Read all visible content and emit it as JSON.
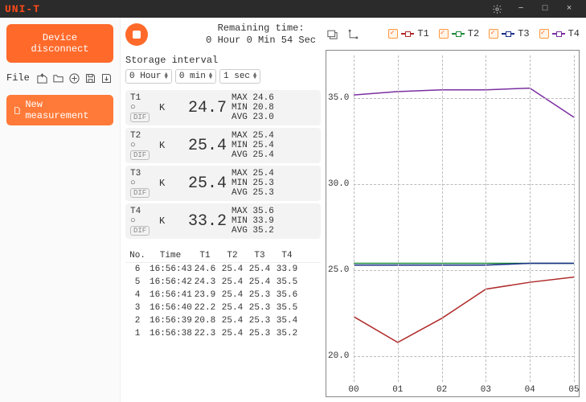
{
  "brand": "UNI-T",
  "window": {
    "gear": "gear",
    "min": "−",
    "max": "□",
    "close": "×"
  },
  "left": {
    "disconnect": "Device disconnect",
    "file_label": "File",
    "new_measurement": "New measurement"
  },
  "header": {
    "remaining_label": "Remaining time:",
    "remaining_value": "0 Hour 0 Min 54 Sec"
  },
  "storage": {
    "label": "Storage interval",
    "hour": "0 Hour",
    "min": "0 min",
    "sec": "1 sec"
  },
  "channels": [
    {
      "name": "T1",
      "unit": "K",
      "value": "24.7",
      "max": "MAX 24.6",
      "min": "MIN 20.8",
      "avg": "AVG 23.0",
      "dif": "DIF"
    },
    {
      "name": "T2",
      "unit": "K",
      "value": "25.4",
      "max": "MAX 25.4",
      "min": "MIN 25.4",
      "avg": "AVG 25.4",
      "dif": "DIF"
    },
    {
      "name": "T3",
      "unit": "K",
      "value": "25.4",
      "max": "MAX 25.4",
      "min": "MIN 25.3",
      "avg": "AVG 25.3",
      "dif": "DIF"
    },
    {
      "name": "T4",
      "unit": "K",
      "value": "33.2",
      "max": "MAX 35.6",
      "min": "MIN 33.9",
      "avg": "AVG 35.2",
      "dif": "DIF"
    }
  ],
  "table": {
    "headers": [
      "No.",
      "Time",
      "T1",
      "T2",
      "T3",
      "T4"
    ],
    "rows": [
      [
        "6",
        "16:56:43",
        "24.6",
        "25.4",
        "25.4",
        "33.9"
      ],
      [
        "5",
        "16:56:42",
        "24.3",
        "25.4",
        "25.4",
        "35.5"
      ],
      [
        "4",
        "16:56:41",
        "23.9",
        "25.4",
        "25.3",
        "35.6"
      ],
      [
        "3",
        "16:56:40",
        "22.2",
        "25.4",
        "25.3",
        "35.5"
      ],
      [
        "2",
        "16:56:39",
        "20.8",
        "25.4",
        "25.3",
        "35.4"
      ],
      [
        "1",
        "16:56:38",
        "22.3",
        "25.4",
        "25.3",
        "35.2"
      ]
    ]
  },
  "legend": [
    "T1",
    "T2",
    "T3",
    "T4"
  ],
  "chart_data": {
    "type": "line",
    "x": [
      0,
      1,
      2,
      3,
      4,
      5
    ],
    "xticks": [
      "00",
      "01",
      "02",
      "03",
      "04",
      "05"
    ],
    "yticks": [
      "20.0",
      "25.0",
      "30.0",
      "35.0"
    ],
    "ylim": [
      18.5,
      37.5
    ],
    "series": [
      {
        "name": "T1",
        "color": "#b02a2a",
        "values": [
          22.3,
          20.8,
          22.2,
          23.9,
          24.3,
          24.6
        ]
      },
      {
        "name": "T2",
        "color": "#1d8a3a",
        "values": [
          25.4,
          25.4,
          25.4,
          25.4,
          25.4,
          25.4
        ]
      },
      {
        "name": "T3",
        "color": "#1a2f8a",
        "values": [
          25.3,
          25.3,
          25.3,
          25.3,
          25.4,
          25.4
        ]
      },
      {
        "name": "T4",
        "color": "#7a2fa0",
        "values": [
          35.2,
          35.4,
          35.5,
          35.5,
          35.6,
          33.9
        ]
      }
    ]
  }
}
